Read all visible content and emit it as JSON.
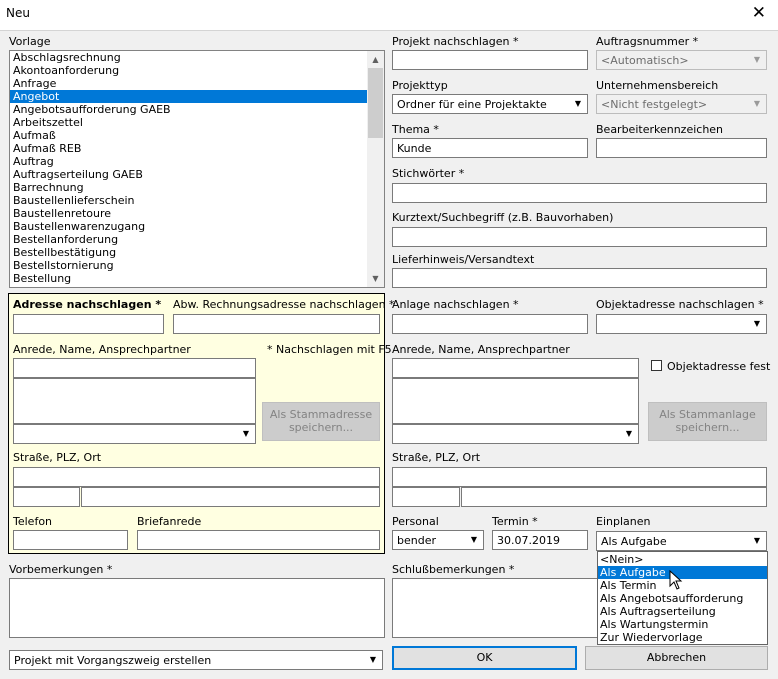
{
  "window": {
    "title": "Neu",
    "close": "✕"
  },
  "vorlage": {
    "label": "Vorlage",
    "items": [
      "Abschlagsrechnung",
      "Akontoanforderung",
      "Anfrage",
      "Angebot",
      "Angebotsaufforderung GAEB",
      "Arbeitszettel",
      "Aufmaß",
      "Aufmaß REB",
      "Auftrag",
      "Auftragserteilung GAEB",
      "Barrechnung",
      "Baustellenlieferschein",
      "Baustellenretoure",
      "Baustellenwarenzugang",
      "Bestellanforderung",
      "Bestellbestätigung",
      "Bestellstornierung",
      "Bestellung"
    ],
    "selected": "Angebot"
  },
  "projekt": {
    "label": "Projekt nachschlagen *",
    "value": "",
    "auftragsnummer_label": "Auftragsnummer *",
    "auftragsnummer_value": "<Automatisch>",
    "projekttyp_label": "Projekttyp",
    "projekttyp_value": "Ordner für eine Projektakte",
    "bereich_label": "Unternehmensbereich",
    "bereich_value": "<Nicht festgelegt>",
    "thema_label": "Thema *",
    "thema_value": "Kunde",
    "bearbeiter_label": "Bearbeiterkennzeichen",
    "bearbeiter_value": "",
    "stichwoerter_label": "Stichwörter *",
    "kurztext_label": "Kurztext/Suchbegriff (z.B. Bauvorhaben)",
    "lieferhinweis_label": "Lieferhinweis/Versandtext"
  },
  "adresse": {
    "label": "Adresse nachschlagen *",
    "abw_label": "Abw. Rechnungsadresse nachschlagen *",
    "anrede_label": "Anrede, Name, Ansprechpartner",
    "hint": "* Nachschlagen mit F5",
    "save_button": "Als Stammadresse speichern...",
    "strasse_label": "Straße, PLZ, Ort",
    "telefon_label": "Telefon",
    "briefanrede_label": "Briefanrede"
  },
  "anlage": {
    "label": "Anlage nachschlagen *",
    "objektadresse_label": "Objektadresse nachschlagen *",
    "anrede_label": "Anrede, Name, Ansprechpartner",
    "objektadresse_fest": "Objektadresse fest",
    "save_button": "Als Stammanlage speichern...",
    "strasse_label": "Straße, PLZ, Ort"
  },
  "planung": {
    "personal_label": "Personal",
    "personal_value": "bender",
    "termin_label": "Termin *",
    "termin_value": "30.07.2019",
    "einplanen_label": "Einplanen",
    "einplanen_value": "Als Aufgabe",
    "options": [
      "<Nein>",
      "Als Aufgabe",
      "Als Termin",
      "Als Angebotsaufforderung",
      "Als Auftragserteilung",
      "Als Wartungstermin",
      "Zur Wiedervorlage"
    ],
    "highlighted": "Als Aufgabe"
  },
  "bemerkungen": {
    "vor_label": "Vorbemerkungen *",
    "schluss_label": "Schlußbemerkungen *"
  },
  "footer": {
    "mode_value": "Projekt mit Vorgangszweig erstellen",
    "ok": "OK",
    "cancel": "Abbrechen"
  }
}
